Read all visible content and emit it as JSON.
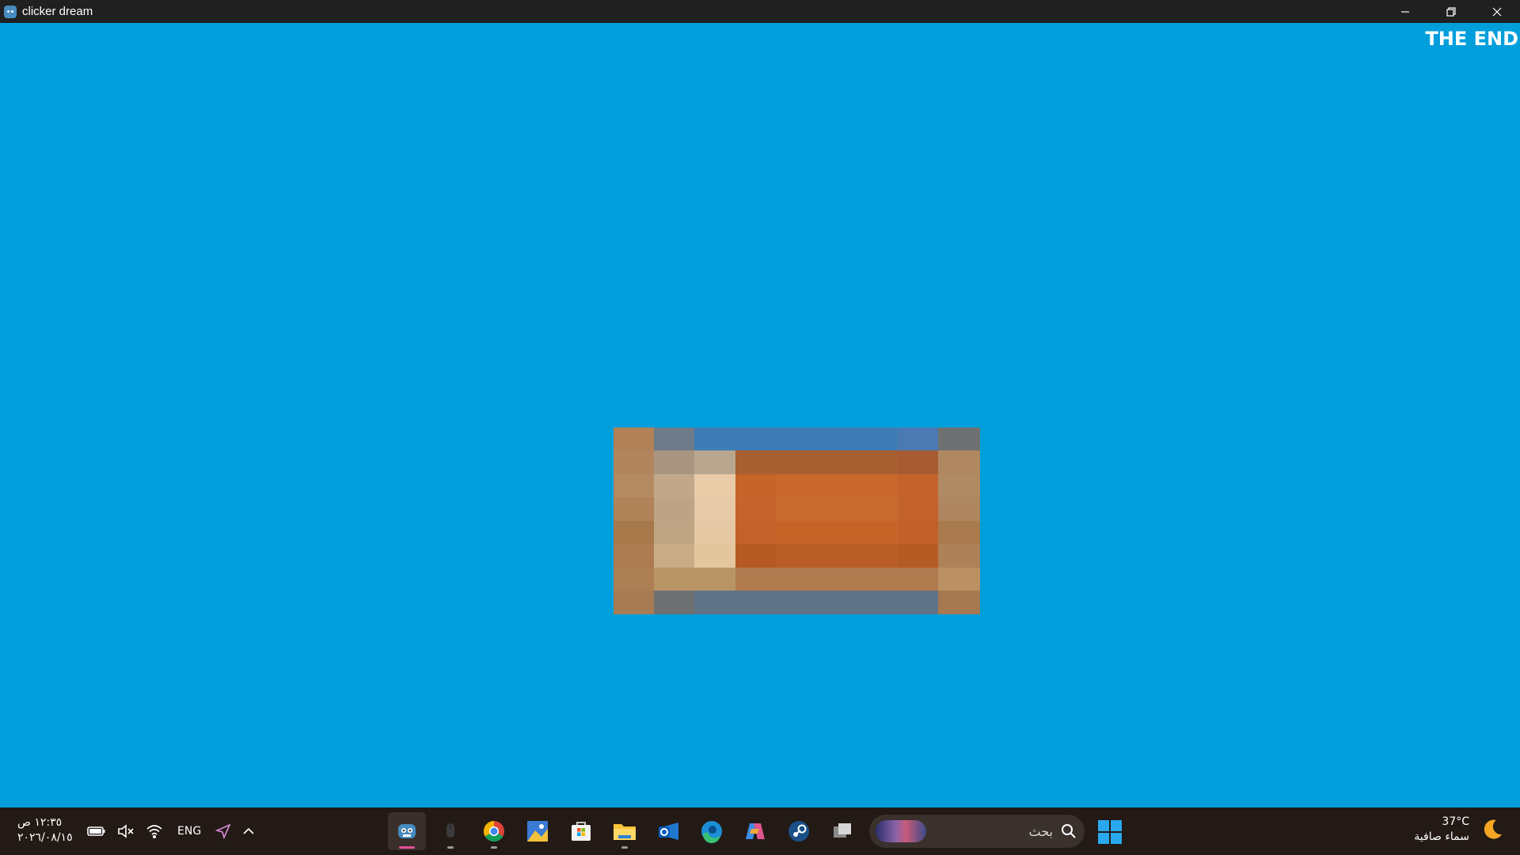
{
  "window": {
    "title": "clicker dream",
    "app_icon": "godot-icon",
    "controls": [
      "minimize-icon",
      "restore-icon",
      "close-icon"
    ]
  },
  "game": {
    "background_color": "#009fdc",
    "end_text": "THE END",
    "sprite_colors": [
      [
        "#b28158",
        "#6e7c8a",
        "#3e7cb6",
        "#3e7cb6",
        "#3e7cb6",
        "#3e7cb6",
        "#3e7cb6",
        "#4b7ab2",
        "#6f7072"
      ],
      [
        "#b3855d",
        "#a99680",
        "#b8a68e",
        "#a85f31",
        "#a85f31",
        "#a85f31",
        "#a85f31",
        "#a85b31",
        "#af8760"
      ],
      [
        "#b38a62",
        "#c0a889",
        "#e9cba8",
        "#c6642a",
        "#c9682d",
        "#c9682d",
        "#c9682d",
        "#c4622b",
        "#b08a62"
      ],
      [
        "#b08358",
        "#bea485",
        "#e6c9a6",
        "#c6622b",
        "#c96a2f",
        "#c96a2f",
        "#c96a2f",
        "#c4622b",
        "#ae8660"
      ],
      [
        "#a77849",
        "#bfa584",
        "#e6c7a3",
        "#c4602a",
        "#c66428",
        "#c66428",
        "#c66428",
        "#c2602a",
        "#a87a4d"
      ],
      [
        "#ac7b50",
        "#c9ab86",
        "#e4c69e",
        "#b45a22",
        "#b85e26",
        "#b85e26",
        "#b85e26",
        "#b55b24",
        "#ae8158"
      ],
      [
        "#ad7f55",
        "#b99465",
        "#b99465",
        "#b07a4f",
        "#b07a4f",
        "#b07a4f",
        "#b07a4f",
        "#b07a4f",
        "#bb9062"
      ],
      [
        "#a77b54",
        "#6f7072",
        "#617388",
        "#617388",
        "#617388",
        "#617388",
        "#617388",
        "#617388",
        "#a57850"
      ]
    ]
  },
  "taskbar": {
    "time": "١٢:٣٥ ص",
    "date": "٢٠٢٦/٠٨/١٥",
    "tray_icons": [
      "battery-icon",
      "speaker-muted-icon",
      "wifi-icon"
    ],
    "language": "ENG",
    "extra_icons": [
      "location-icon",
      "chevron-up-icon"
    ],
    "apps": [
      {
        "name": "godot-app",
        "active": true
      },
      {
        "name": "mouse-app",
        "active": false,
        "running": true
      },
      {
        "name": "chrome-app",
        "active": false,
        "running": true
      },
      {
        "name": "photos-app",
        "active": false
      },
      {
        "name": "store-app",
        "active": false
      },
      {
        "name": "files-app",
        "active": false,
        "running": true
      },
      {
        "name": "outlook-app",
        "active": false
      },
      {
        "name": "edge-app",
        "active": false
      },
      {
        "name": "copilot-app",
        "active": false
      },
      {
        "name": "steam-app",
        "active": false
      },
      {
        "name": "taskview-app",
        "active": false
      }
    ],
    "search_placeholder": "بحث",
    "weather": {
      "temperature": "37°C",
      "condition": "سماء صافية"
    }
  }
}
